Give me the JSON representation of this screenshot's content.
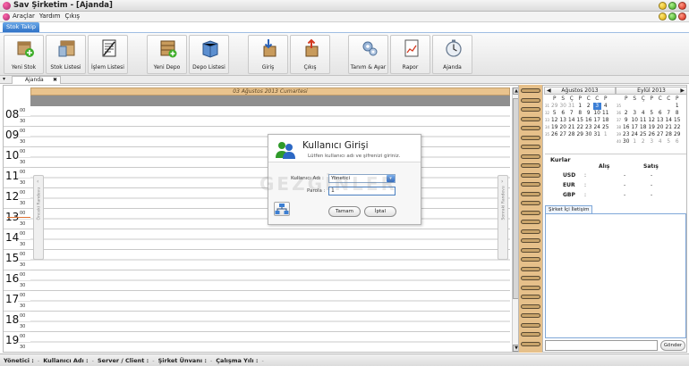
{
  "window": {
    "title": "Sav Şirketim - [Ajanda]"
  },
  "menu": {
    "items": [
      "Araçlar",
      "Yardım",
      "Çıkış"
    ]
  },
  "ribbon": {
    "tab": "Stok Takip",
    "buttons": [
      "Yeni Stok",
      "Stok Listesi",
      "İşlem Listesi",
      "Yeni Depo",
      "Depo Listesi",
      "Giriş",
      "Çıkış",
      "Tanım & Ayar",
      "Rapor",
      "Ajanda"
    ]
  },
  "doc_tab": {
    "label": "Ajanda",
    "dropdown": "▾",
    "close": "✖"
  },
  "day_view": {
    "date_header": "03 Ağustos 2013 Cumartesi",
    "hours": [
      "08",
      "09",
      "10",
      "11",
      "12",
      "13",
      "14",
      "15",
      "16",
      "17",
      "18",
      "19"
    ],
    "minute_top": "00",
    "minute_half": "30",
    "left_panel_label": "Önceki Randevu",
    "right_panel_label": "Sonraki Randevu",
    "scroll_up": "▲",
    "scroll_down": "▼"
  },
  "calendars": [
    {
      "month": "Ağustos 2013",
      "nav": "◀",
      "weekdays": [
        "P",
        "S",
        "Ç",
        "P",
        "C",
        "C",
        "P"
      ],
      "weeks": [
        {
          "wk": "31",
          "days": [
            "29",
            "30",
            "31",
            "1",
            "2",
            "3",
            "4"
          ]
        },
        {
          "wk": "32",
          "days": [
            "5",
            "6",
            "7",
            "8",
            "9",
            "10",
            "11"
          ]
        },
        {
          "wk": "33",
          "days": [
            "12",
            "13",
            "14",
            "15",
            "16",
            "17",
            "18"
          ]
        },
        {
          "wk": "34",
          "days": [
            "19",
            "20",
            "21",
            "22",
            "23",
            "24",
            "25"
          ]
        },
        {
          "wk": "35",
          "days": [
            "26",
            "27",
            "28",
            "29",
            "30",
            "31",
            "1"
          ]
        },
        {
          "wk": "",
          "days": [
            "",
            "",
            "",
            "",
            "",
            "",
            ""
          ]
        }
      ],
      "selected": "3"
    },
    {
      "month": "Eylül 2013",
      "nav": "▶",
      "weekdays": [
        "P",
        "S",
        "Ç",
        "P",
        "C",
        "C",
        "P"
      ],
      "weeks": [
        {
          "wk": "35",
          "days": [
            "",
            "",
            "",
            "",
            "",
            "",
            "1"
          ]
        },
        {
          "wk": "36",
          "days": [
            "2",
            "3",
            "4",
            "5",
            "6",
            "7",
            "8"
          ]
        },
        {
          "wk": "37",
          "days": [
            "9",
            "10",
            "11",
            "12",
            "13",
            "14",
            "15"
          ]
        },
        {
          "wk": "38",
          "days": [
            "16",
            "17",
            "18",
            "19",
            "20",
            "21",
            "22"
          ]
        },
        {
          "wk": "39",
          "days": [
            "23",
            "24",
            "25",
            "26",
            "27",
            "28",
            "29"
          ]
        },
        {
          "wk": "40",
          "days": [
            "30",
            "1",
            "2",
            "3",
            "4",
            "5",
            "6"
          ]
        }
      ],
      "selected": ""
    }
  ],
  "rates": {
    "title": "Kurlar",
    "buy": "Alış",
    "sell": "Satış",
    "rows": [
      {
        "cur": "USD",
        "buy": "-",
        "sell": "-"
      },
      {
        "cur": "EUR",
        "buy": "-",
        "sell": "-"
      },
      {
        "cur": "GBP",
        "buy": "-",
        "sell": "-"
      }
    ]
  },
  "comm": {
    "tab": "Şirket İçi İletişim",
    "send": "Gönder"
  },
  "status": {
    "items": [
      "Yönetici :",
      "Kullanıcı Adı :",
      "Server / Client :",
      "Şirket Ünvanı :",
      "Çalışma Yılı :"
    ]
  },
  "login": {
    "title": "Kullanıcı Girişi",
    "subtitle": "Lütfen kullanıcı adı ve şifrenizi giriniz.",
    "user_label": "Kullanıcı Adı :",
    "user_value": "Yönetici",
    "pass_label": "Parola :",
    "pass_value": "1",
    "ok": "Tamam",
    "cancel": "İptal"
  },
  "watermark": "GEZGİNLER",
  "colors": {
    "accent": "#2f72c6",
    "date_header": "#e9c38d",
    "spiral": "#e6c08a"
  }
}
